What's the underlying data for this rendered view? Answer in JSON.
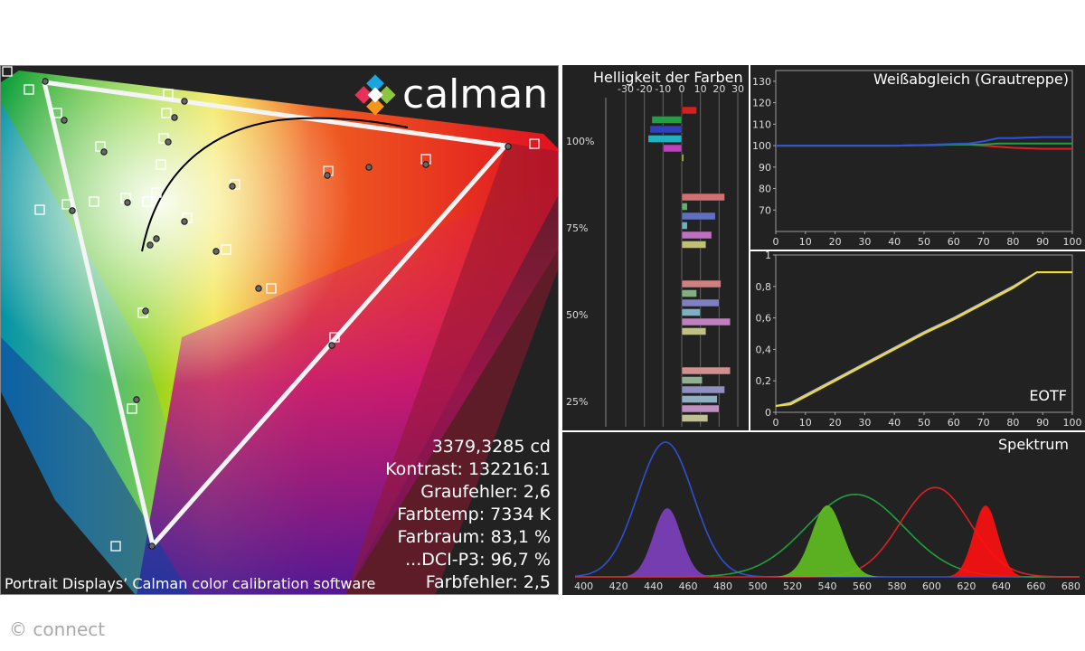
{
  "brand": {
    "logo_text": "calman",
    "copyright": "© connect"
  },
  "cie": {
    "caption": "Portrait Displays’ Calman color calibration software",
    "stats": [
      "3379,3285 cd",
      "Kontrast: 132216:1",
      "Graufehler: 2,6",
      "Farbtemp: 7334 K",
      "Farbraum: 83,1 %",
      "...DCI-P3: 96,7 %",
      "Farbfehler: 2,5"
    ]
  },
  "chart_data": [
    {
      "type": "bar",
      "title": "Helligkeit der Farben",
      "xlim": [
        -30,
        30
      ],
      "x_ticks": [
        "-30",
        "-20",
        "-10",
        "0",
        "10",
        "20",
        "30"
      ],
      "y_labels": [
        "100%",
        "75%",
        "50%",
        "25%"
      ],
      "groups": [
        {
          "level": "100%",
          "bars": [
            {
              "color": "#d02020",
              "value": 8
            },
            {
              "color": "#20a040",
              "value": -16
            },
            {
              "color": "#3040c0",
              "value": -17
            },
            {
              "color": "#20b0c0",
              "value": -18
            },
            {
              "color": "#c040c0",
              "value": -10
            },
            {
              "color": "#c0c030",
              "value": 1
            }
          ]
        },
        {
          "level": "75%",
          "bars": [
            {
              "color": "#d07070",
              "value": 23
            },
            {
              "color": "#60b070",
              "value": 3
            },
            {
              "color": "#6070c0",
              "value": 18
            },
            {
              "color": "#70b0c0",
              "value": 3
            },
            {
              "color": "#c070c0",
              "value": 16
            },
            {
              "color": "#c0c070",
              "value": 13
            }
          ]
        },
        {
          "level": "50%",
          "bars": [
            {
              "color": "#d08080",
              "value": 21
            },
            {
              "color": "#80b080",
              "value": 8
            },
            {
              "color": "#8080c0",
              "value": 20
            },
            {
              "color": "#80b0c0",
              "value": 10
            },
            {
              "color": "#c080c0",
              "value": 26
            },
            {
              "color": "#c0c080",
              "value": 13
            }
          ]
        },
        {
          "level": "25%",
          "bars": [
            {
              "color": "#d09090",
              "value": 26
            },
            {
              "color": "#90b090",
              "value": 11
            },
            {
              "color": "#9090c0",
              "value": 23
            },
            {
              "color": "#90b0c0",
              "value": 19
            },
            {
              "color": "#c090c0",
              "value": 20
            },
            {
              "color": "#c0c090",
              "value": 14
            }
          ]
        }
      ]
    },
    {
      "type": "line",
      "title": "Weißabgleich (Grautreppe)",
      "xlim": [
        0,
        100
      ],
      "ylim": [
        60,
        135
      ],
      "x_ticks": [
        "0",
        "10",
        "20",
        "30",
        "40",
        "50",
        "60",
        "70",
        "80",
        "90",
        "100"
      ],
      "y_ticks": [
        "70",
        "80",
        "90",
        "100",
        "110",
        "120",
        "130"
      ],
      "x": [
        0,
        10,
        20,
        30,
        40,
        50,
        60,
        65,
        70,
        75,
        80,
        90,
        100
      ],
      "series": [
        {
          "color": "#e02020",
          "values": [
            100,
            100,
            100,
            100,
            100,
            100.2,
            100.5,
            100.5,
            100,
            99.5,
            99,
            98.5,
            98.5
          ]
        },
        {
          "color": "#20a040",
          "values": [
            100,
            100,
            100,
            100,
            100,
            100.2,
            100.5,
            100.5,
            100.5,
            101,
            101,
            101,
            101
          ]
        },
        {
          "color": "#3050e0",
          "values": [
            100,
            100,
            100,
            100,
            100,
            100.3,
            100.8,
            101,
            102,
            103.5,
            103.5,
            104,
            104
          ]
        }
      ]
    },
    {
      "type": "line",
      "title": "EOTF",
      "xlim": [
        0,
        100
      ],
      "ylim": [
        0,
        1
      ],
      "x_ticks": [
        "0",
        "10",
        "20",
        "30",
        "40",
        "50",
        "60",
        "70",
        "80",
        "90",
        "100"
      ],
      "y_ticks": [
        "0",
        "0,2",
        "0,4",
        "0,6",
        "0,8",
        "1"
      ],
      "x": [
        0,
        5,
        10,
        20,
        30,
        40,
        50,
        60,
        70,
        80,
        88,
        90,
        100
      ],
      "series": [
        {
          "color": "#c0c0c0",
          "values": [
            0.04,
            0.06,
            0.11,
            0.21,
            0.31,
            0.41,
            0.51,
            0.6,
            0.7,
            0.8,
            0.89,
            0.89,
            0.89
          ]
        },
        {
          "color": "#f0e020",
          "values": [
            0.04,
            0.05,
            0.1,
            0.2,
            0.3,
            0.4,
            0.5,
            0.59,
            0.69,
            0.79,
            0.89,
            0.89,
            0.89
          ]
        }
      ]
    },
    {
      "type": "area",
      "title": "Spektrum",
      "xlim": [
        395,
        685
      ],
      "x_ticks": [
        "400",
        "420",
        "440",
        "460",
        "480",
        "500",
        "520",
        "540",
        "560",
        "580",
        "600",
        "620",
        "640",
        "660",
        "680"
      ],
      "series": [
        {
          "color": "#3050d0",
          "peak_nm": 447,
          "level": 0.98
        },
        {
          "color": "#20a040",
          "peak_nm": 556,
          "level": 0.6
        },
        {
          "color": "#e02020",
          "peak_nm": 602,
          "level": 0.65
        },
        {
          "color": "#8040c0",
          "peak_nm": 448,
          "level": 0.5
        },
        {
          "color": "#60c020",
          "peak_nm": 540,
          "level": 0.52
        },
        {
          "color": "#ff1010",
          "peak_nm": 631,
          "level": 0.52
        }
      ]
    }
  ]
}
